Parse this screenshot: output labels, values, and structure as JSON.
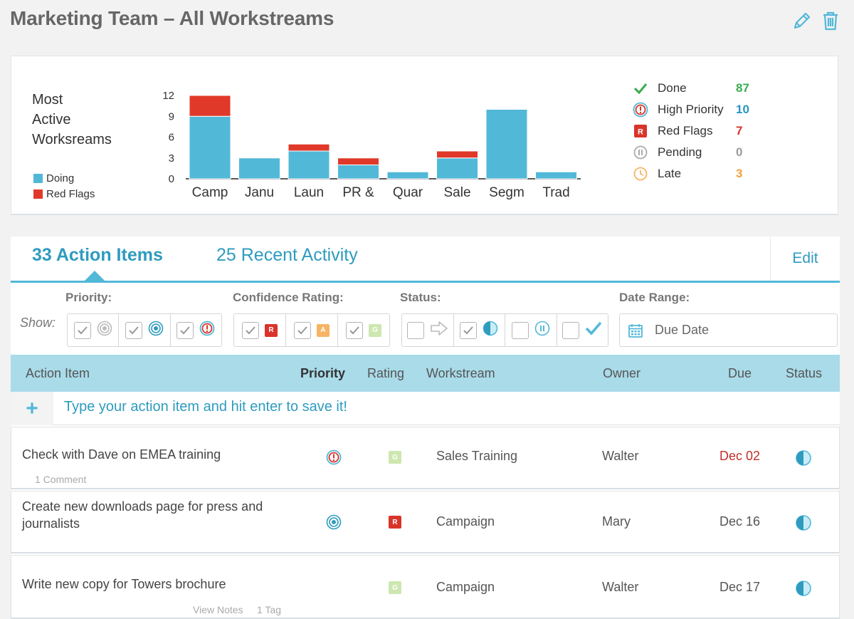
{
  "page": {
    "title": "Marketing Team – All Workstreams"
  },
  "top_icons": [
    "pencil-icon",
    "trash-icon"
  ],
  "chart": {
    "title_lines": [
      "Most",
      "Active",
      "Worksreams"
    ],
    "legend": [
      {
        "label": "Doing",
        "color": "#52b8d8"
      },
      {
        "label": "Red Flags",
        "color": "#e0392a"
      }
    ]
  },
  "chart_data": {
    "type": "bar",
    "stacked": true,
    "categories": [
      "Camp",
      "Janu",
      "Laun",
      "PR &",
      "Quar",
      "Sale",
      "Segm",
      "Trad"
    ],
    "series": [
      {
        "name": "Doing",
        "color": "#52b8d8",
        "values": [
          9,
          3,
          4,
          2,
          1,
          3,
          10,
          1
        ]
      },
      {
        "name": "Red Flags",
        "color": "#e0392a",
        "values": [
          3,
          0,
          1,
          1,
          0,
          1,
          0,
          0
        ]
      }
    ],
    "yticks": [
      0,
      3,
      6,
      9,
      12
    ],
    "ylim": [
      0,
      12
    ],
    "title": "Most Active Worksreams",
    "xlabel": "",
    "ylabel": "",
    "grid": false,
    "legend_position": "left"
  },
  "stats": [
    {
      "icon": "check-icon",
      "label": "Done",
      "value": "87",
      "color": "#3aab4f"
    },
    {
      "icon": "high-priority-icon",
      "label": "High Priority",
      "value": "10",
      "color": "#2a95c2"
    },
    {
      "icon": "red-flag-icon",
      "label": "Red Flags",
      "value": "7",
      "color": "#d9342a"
    },
    {
      "icon": "pending-icon",
      "label": "Pending",
      "value": "0",
      "color": "#9a9a9a"
    },
    {
      "icon": "late-clock-icon",
      "label": "Late",
      "value": "3",
      "color": "#f0a23a"
    }
  ],
  "tabs": {
    "active": "33 Action Items",
    "recent": "25 Recent Activity",
    "edit": "Edit"
  },
  "filters": {
    "show_label": "Show:",
    "priority_label": "Priority:",
    "confidence_label": "Confidence Rating:",
    "status_label": "Status:",
    "date_label": "Date Range:",
    "date_placeholder": "Due Date",
    "rating_letters": [
      "R",
      "A",
      "G"
    ]
  },
  "table": {
    "headers": {
      "action_item": "Action Item",
      "priority": "Priority",
      "rating": "Rating",
      "workstream": "Workstream",
      "owner": "Owner",
      "due": "Due",
      "status": "Status"
    },
    "add_placeholder": "Type your action item and hit enter to save it!",
    "add_symbol": "+",
    "rows": [
      {
        "title": "Check with Dave on EMEA training",
        "meta": [
          "1 Comment"
        ],
        "priority_icon": "high-priority-icon",
        "rating": "G",
        "workstream": "Sales Training",
        "owner": "Walter",
        "due": "Dec 02",
        "due_color": "#c0302a",
        "status_icon": "in-progress-icon"
      },
      {
        "title": "Create new downloads page for press and journalists",
        "meta": [],
        "priority_icon": "medium-priority-icon",
        "rating": "R",
        "workstream": "Campaign",
        "owner": "Mary",
        "due": "Dec 16",
        "due_color": "#555555",
        "status_icon": "in-progress-icon"
      },
      {
        "title": "Write new copy for Towers brochure",
        "meta": [
          "View Notes",
          "1 Tag"
        ],
        "priority_icon": "",
        "rating": "G",
        "workstream": "Campaign",
        "owner": "Walter",
        "due": "Dec 17",
        "due_color": "#555555",
        "status_icon": "in-progress-icon"
      }
    ]
  }
}
